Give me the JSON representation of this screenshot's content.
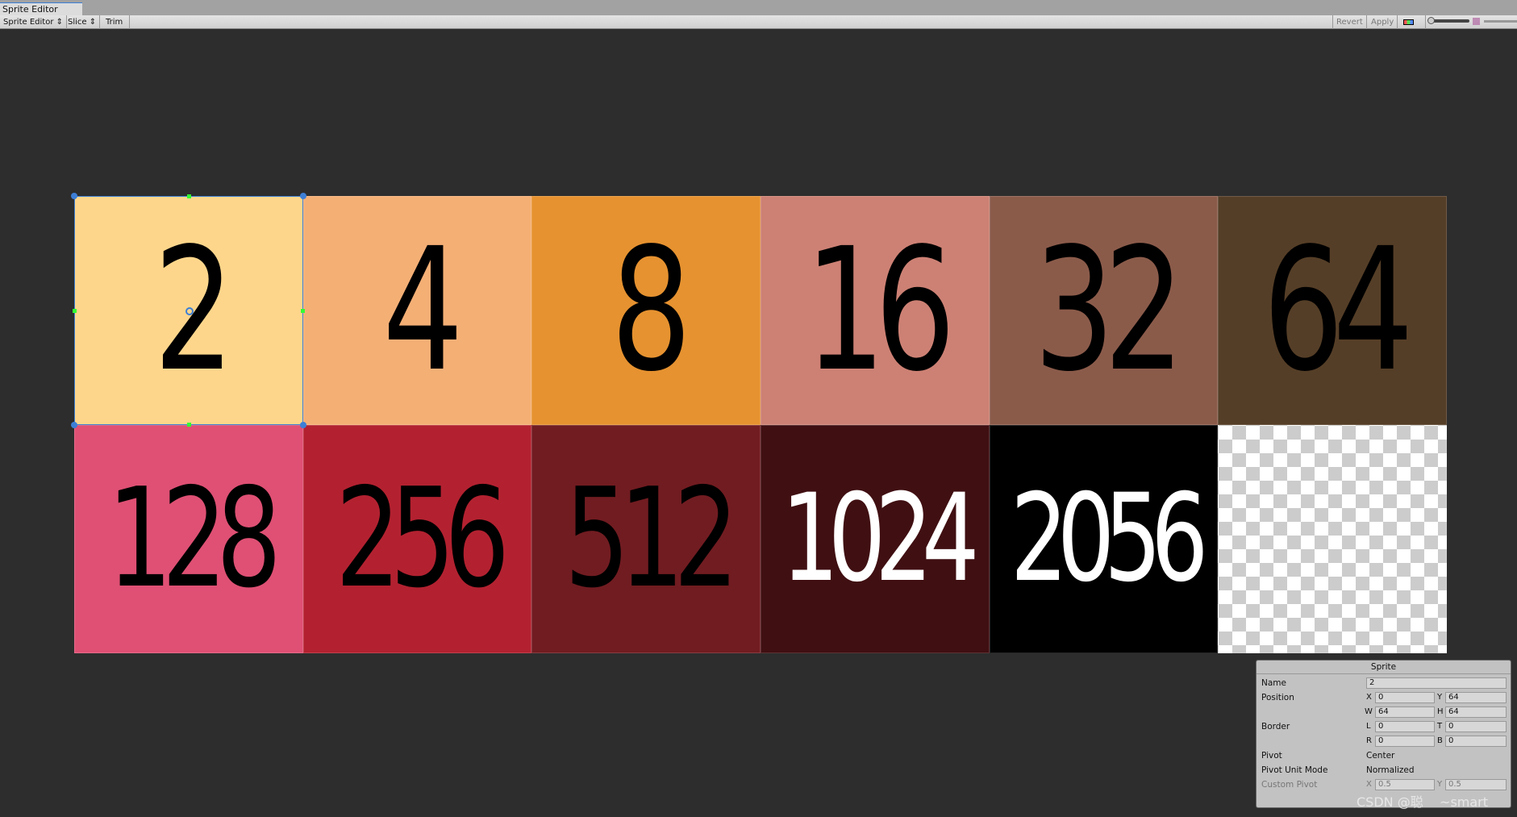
{
  "window": {
    "tab_title": "Sprite Editor"
  },
  "toolbar": {
    "mode": "Sprite Editor ⇕",
    "slice": "Slice ⇕",
    "trim": "Trim",
    "revert": "Revert",
    "apply": "Apply"
  },
  "sprites": [
    {
      "label": "2",
      "bg": "#fed68b",
      "fg": "#000000"
    },
    {
      "label": "4",
      "bg": "#f4af75",
      "fg": "#000000"
    },
    {
      "label": "8",
      "bg": "#e69230",
      "fg": "#000000"
    },
    {
      "label": "16",
      "bg": "#cd8174",
      "fg": "#000000"
    },
    {
      "label": "32",
      "bg": "#8b5b4a",
      "fg": "#000000"
    },
    {
      "label": "64",
      "bg": "#553e27",
      "fg": "#000000"
    },
    {
      "label": "128",
      "bg": "#df5074",
      "fg": "#000000"
    },
    {
      "label": "256",
      "bg": "#b32130",
      "fg": "#000000"
    },
    {
      "label": "512",
      "bg": "#711c21",
      "fg": "#000000"
    },
    {
      "label": "1024",
      "bg": "#400f12",
      "fg": "#ffffff"
    },
    {
      "label": "2056",
      "bg": "#000000",
      "fg": "#ffffff"
    },
    {
      "label": "",
      "bg": "checker",
      "fg": ""
    }
  ],
  "panel": {
    "title": "Sprite",
    "name_label": "Name",
    "name": "2",
    "position_label": "Position",
    "x_label": "X",
    "x": "0",
    "y_label": "Y",
    "y": "64",
    "w_label": "W",
    "w": "64",
    "h_label": "H",
    "h": "64",
    "border_label": "Border",
    "l_label": "L",
    "l": "0",
    "t_label": "T",
    "t": "0",
    "r_label": "R",
    "r": "0",
    "b_label": "B",
    "b": "0",
    "pivot_label": "Pivot",
    "pivot": "Center",
    "pivot_unit_label": "Pivot Unit Mode",
    "pivot_unit": "Normalized",
    "custom_pivot_label": "Custom Pivot",
    "cx_label": "X",
    "cx": "0.5",
    "cy_label": "Y",
    "cy": "0.5"
  },
  "watermark": "CSDN @聪    ~smart"
}
